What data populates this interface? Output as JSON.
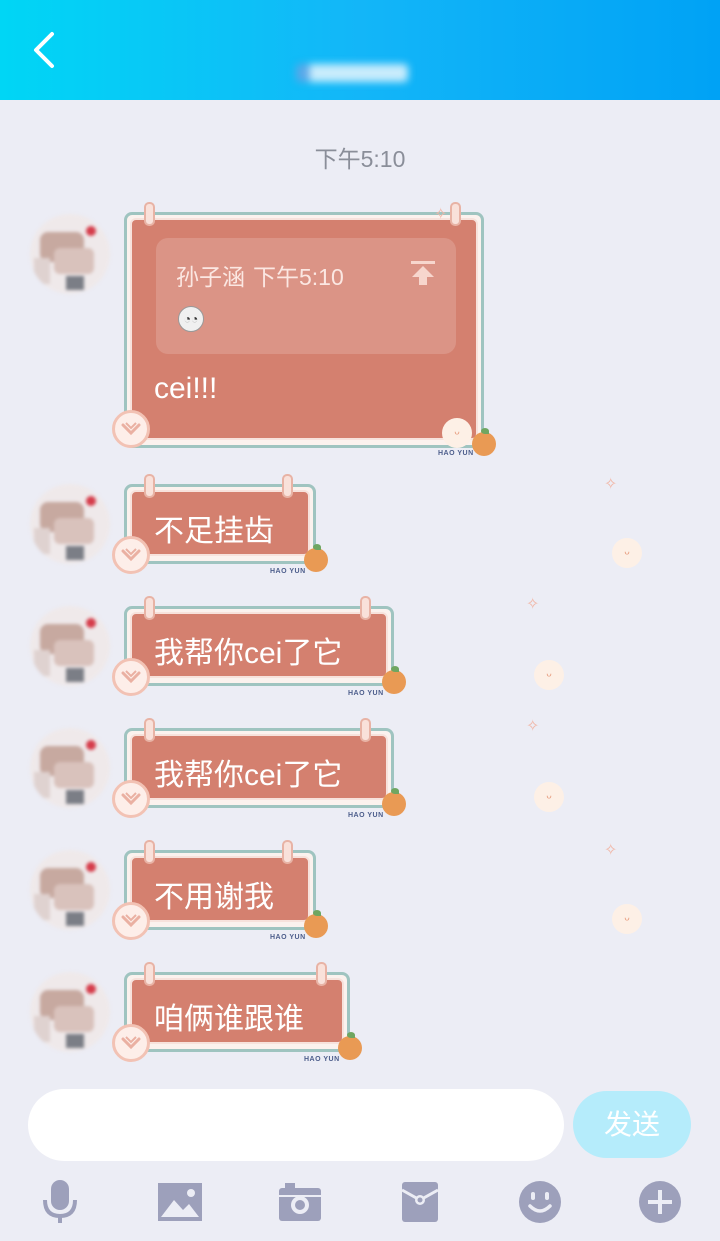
{
  "header": {
    "title": "",
    "back_icon": "chevron-left-icon"
  },
  "time_divider": "下午5:10",
  "messages": [
    {
      "quote": {
        "author": "孙子涵",
        "time": "下午5:10",
        "emoji": "sticker-emoji"
      },
      "text": "cei!!!"
    },
    {
      "text": "不足挂齿"
    },
    {
      "text": "我帮你cei了它"
    },
    {
      "text": "我帮你cei了它"
    },
    {
      "text": "不用谢我"
    },
    {
      "text": "咱俩谁跟谁"
    }
  ],
  "bubble_brand": "HAO YUN",
  "input": {
    "value": "",
    "placeholder": ""
  },
  "send_label": "发送",
  "toolbar": [
    {
      "icon": "microphone-icon"
    },
    {
      "icon": "image-icon"
    },
    {
      "icon": "camera-icon"
    },
    {
      "icon": "red-packet-icon"
    },
    {
      "icon": "emoji-icon"
    },
    {
      "icon": "plus-icon"
    }
  ],
  "colors": {
    "header_start": "#00d6f5",
    "header_end": "#00a2f5",
    "bubble": "#d4806f",
    "background": "#ecedf5",
    "send_button": "#b5ecfb",
    "toolbar_icon": "#9da0bb"
  }
}
